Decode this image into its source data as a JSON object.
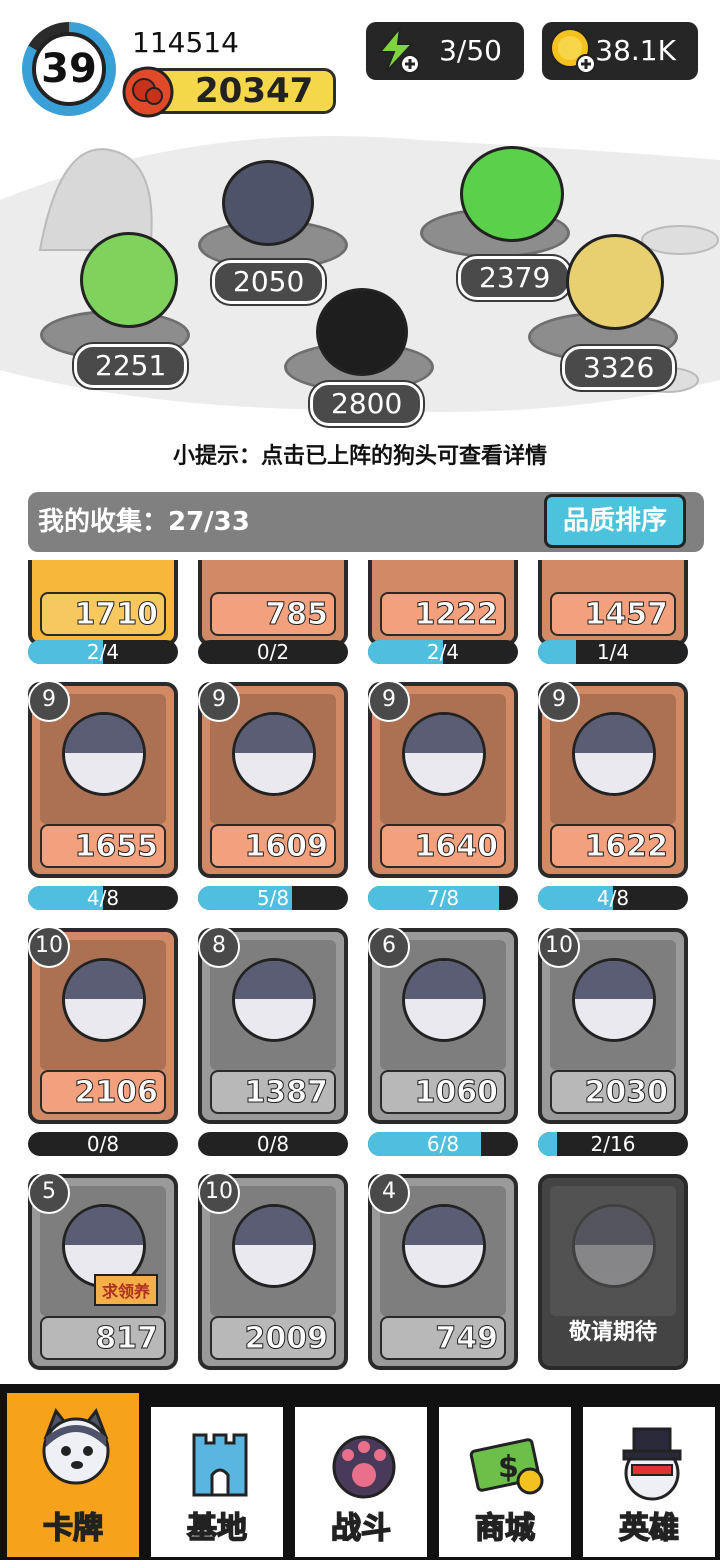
{
  "player": {
    "level": "39",
    "id": "114514",
    "power": "20347"
  },
  "resources": {
    "energy": "3/50",
    "coins": "38.1K"
  },
  "arena": {
    "scores": [
      "2050",
      "2379",
      "2251",
      "2800",
      "3326"
    ]
  },
  "hint": "小提示：点击已上阵的狗头可查看详情",
  "collection": {
    "title": "我的收集：27/33",
    "sort_label": "品质排序"
  },
  "cards_row0": [
    {
      "power": "1710",
      "progress": "2/4",
      "fill": 0.5
    },
    {
      "power": "785",
      "progress": "0/2",
      "fill": 0
    },
    {
      "power": "1222",
      "progress": "2/4",
      "fill": 0.5
    },
    {
      "power": "1457",
      "progress": "1/4",
      "fill": 0.25
    }
  ],
  "cards_row1": [
    {
      "level": "9",
      "power": "1655",
      "progress": "4/8",
      "fill": 0.5
    },
    {
      "level": "9",
      "power": "1609",
      "progress": "5/8",
      "fill": 0.625
    },
    {
      "level": "9",
      "power": "1640",
      "progress": "7/8",
      "fill": 0.875
    },
    {
      "level": "9",
      "power": "1622",
      "progress": "4/8",
      "fill": 0.5
    }
  ],
  "cards_row2": [
    {
      "level": "10",
      "power": "2106",
      "progress": "0/8",
      "fill": 0
    },
    {
      "level": "8",
      "power": "1387",
      "progress": "0/8",
      "fill": 0
    },
    {
      "level": "6",
      "power": "1060",
      "progress": "6/8",
      "fill": 0.75
    },
    {
      "level": "10",
      "power": "2030",
      "progress": "2/16",
      "fill": 0.125
    }
  ],
  "cards_row3": [
    {
      "level": "5",
      "power": "817",
      "badge": "求领养"
    },
    {
      "level": "10",
      "power": "2009"
    },
    {
      "level": "4",
      "power": "749"
    },
    {
      "locked_label": "敬请期待"
    }
  ],
  "nav": [
    {
      "label": "卡牌",
      "icon": "dog-head-icon"
    },
    {
      "label": "基地",
      "icon": "castle-icon"
    },
    {
      "label": "战斗",
      "icon": "paw-icon"
    },
    {
      "label": "商城",
      "icon": "money-icon"
    },
    {
      "label": "英雄",
      "icon": "top-hat-dog-icon"
    }
  ],
  "colors": {
    "accent": "#4dc2dc",
    "nav_active": "#f7a21b",
    "bronze": "#d28a66",
    "silver": "#9a9a9a",
    "gold": "#f7b73a"
  }
}
